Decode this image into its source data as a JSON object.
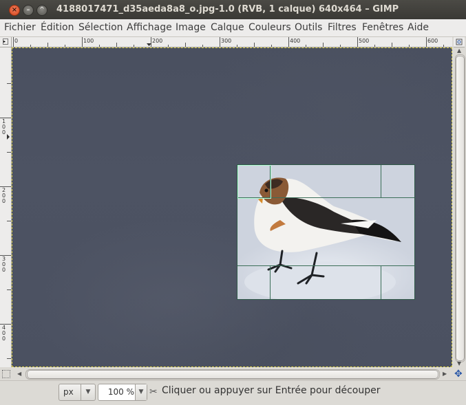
{
  "window": {
    "title": "4188017471_d35aeda8a8_o.jpg-1.0 (RVB, 1 calque) 640x464 – GIMP",
    "close_glyph": "×",
    "minimize_glyph": "–",
    "maximize_glyph": "^"
  },
  "menu": [
    "Fichier",
    "Édition",
    "Sélection",
    "Affichage",
    "Image",
    "Calque",
    "Couleurs",
    "Outils",
    "Filtres",
    "Fenêtres",
    "Aide"
  ],
  "rulers": {
    "horizontal": [
      "0",
      "100",
      "200",
      "300",
      "400",
      "500",
      "600"
    ],
    "vertical": [
      "100",
      "200",
      "300",
      "400"
    ]
  },
  "statusbar": {
    "unit": "px",
    "zoom": "100 %",
    "message": "Cliquer ou appuyer sur Entrée pour découper"
  },
  "icons": {
    "ruler_corner": "quick-mask-toggle-icon",
    "navigate": "navigate-icon",
    "crop_tool": "crop-tool-icon"
  },
  "colors": {
    "selection_outline": "#e3d64c",
    "crop_guides": "#3b6e58",
    "canvas_dim": "#4c5261"
  }
}
